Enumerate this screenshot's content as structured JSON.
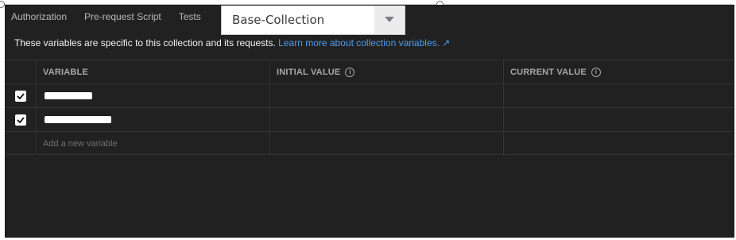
{
  "tabs": [
    {
      "label": "Authorization"
    },
    {
      "label": "Pre-request Script"
    },
    {
      "label": "Tests"
    }
  ],
  "collection_dropdown": {
    "value": "Base-Collection",
    "icon": "triangle-down-icon"
  },
  "info": {
    "text": "These variables are specific to this collection and its requests.",
    "link": "Learn more about collection variables. ↗"
  },
  "table": {
    "headers": {
      "variable": "VARIABLE",
      "initial_value": "INITIAL VALUE",
      "current_value": "CURRENT VALUE"
    },
    "rows": [
      {
        "checked": true,
        "variable": "[redacted]",
        "initial_value": "",
        "current_value": ""
      },
      {
        "checked": true,
        "variable": "[redacted]",
        "initial_value": "",
        "current_value": ""
      }
    ],
    "add_placeholder": "Add a new variable"
  },
  "colors": {
    "panel_bg": "#212121",
    "link": "#4d9cf2",
    "grid": "#333333"
  }
}
